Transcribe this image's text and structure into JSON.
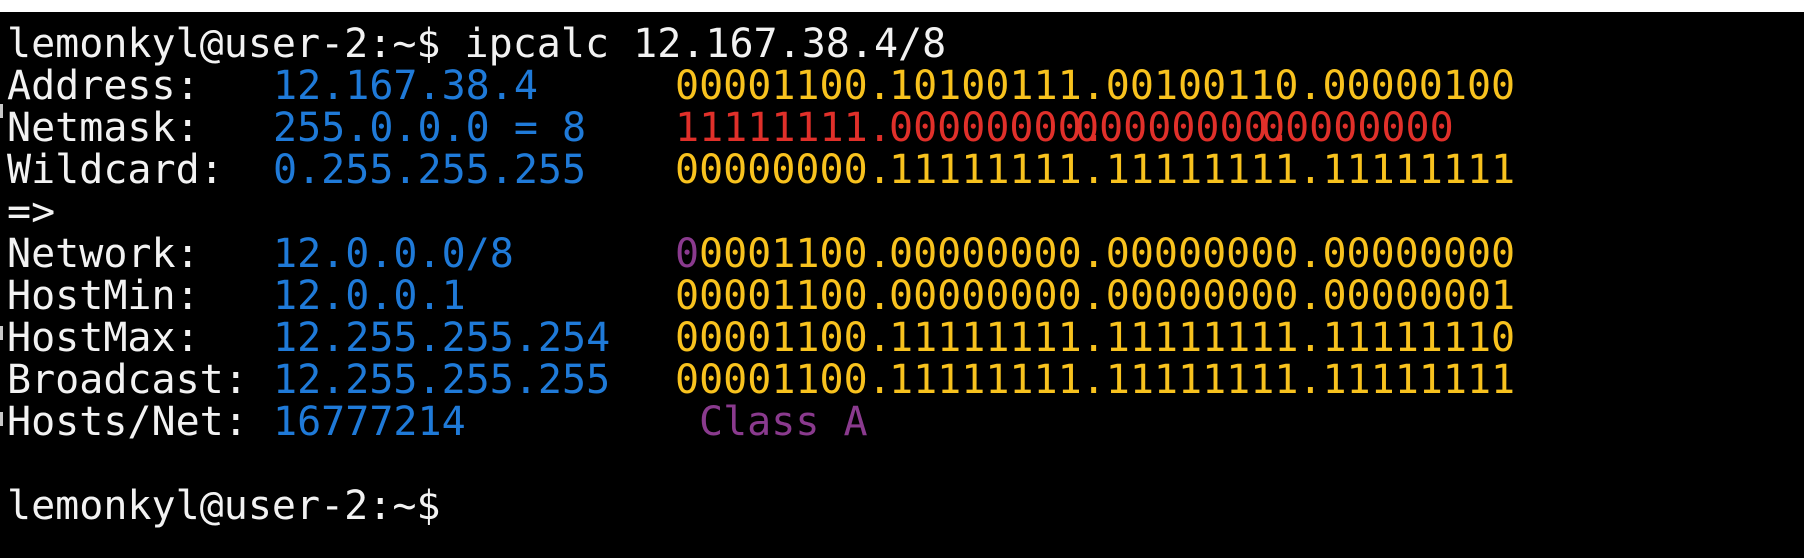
{
  "terminal": {
    "prompt": "lemonkyl@user-2:~$ ipcalc 12.167.38.4/8",
    "rows": [
      {
        "label": "Address:",
        "value": "12.167.38.4",
        "bin_a": "00001100.",
        "bin_b": "10100111.00100110.00000100"
      },
      {
        "label": "Netmask:",
        "value": "255.0.0.0 = 8",
        "bin_a": "11111111.",
        "bin_b1": "00000000.",
        "bin_b2": "00000000.",
        "bin_b3": "00000000"
      },
      {
        "label": "Wildcard:",
        "value": "0.255.255.255",
        "bin_a": "00000000.",
        "bin_b": "11111111.11111111.11111111"
      },
      {
        "label": "=>"
      },
      {
        "label": "Network:",
        "value": "12.0.0.0/8",
        "bin_lead": "0",
        "bin_a": "0001100.",
        "bin_b": "00000000.00000000.00000000"
      },
      {
        "label": "HostMin:",
        "value": "12.0.0.1",
        "bin_a": "00001100.",
        "bin_b": "00000000.00000000.00000001"
      },
      {
        "label": "HostMax:",
        "value": "12.255.255.254",
        "bin_a": "00001100.",
        "bin_b": "11111111.11111111.11111110"
      },
      {
        "label": "Broadcast:",
        "value": "12.255.255.255",
        "bin_a": "00001100.",
        "bin_b": "11111111.11111111.11111111"
      },
      {
        "label": "Hosts/Net:",
        "value": "16777214",
        "class_label": "Class A"
      }
    ],
    "next_prompt": "lemonkyl@user-2:~$"
  },
  "colors": {
    "background": "#000000",
    "label": "#f2f2f2",
    "value": "#1f7ad8",
    "binary": "#f8c21e",
    "netmask_bits": "#e0302a",
    "class": "#8a3a8e"
  }
}
